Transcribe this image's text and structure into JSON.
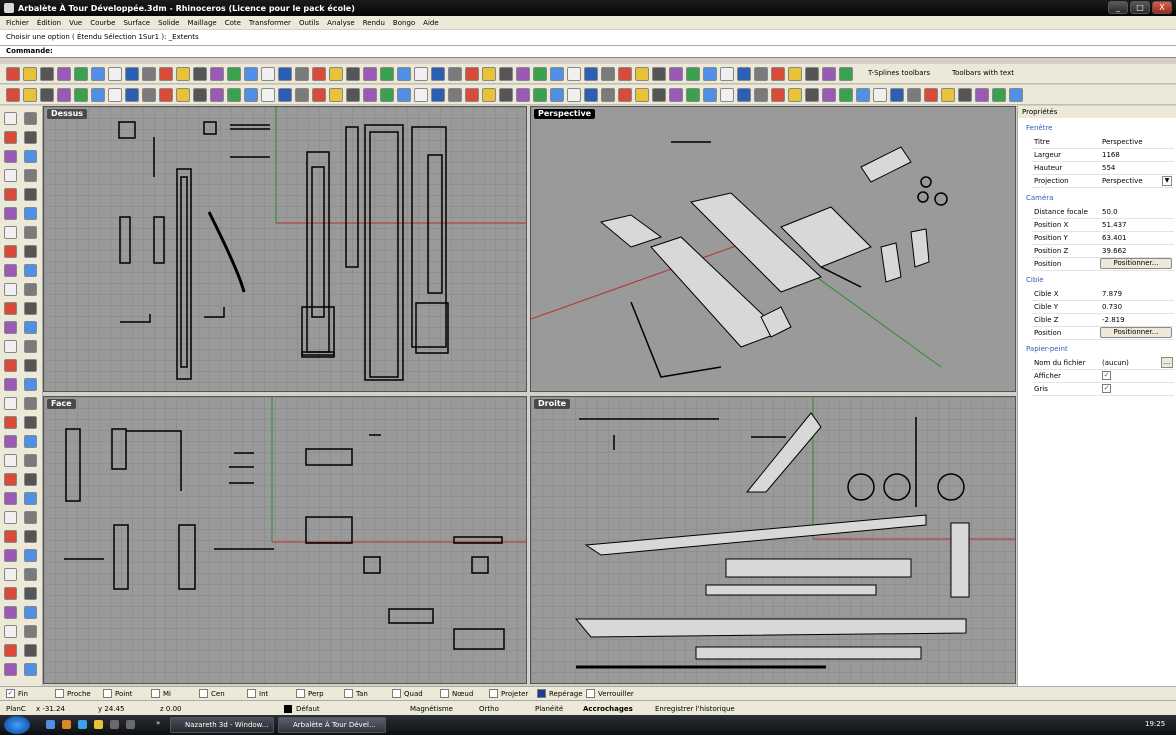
{
  "window": {
    "title": "Arbalète À Tour Développée.3dm - Rhinoceros (Licence pour le pack école)",
    "minimize": "_",
    "maximize": "□",
    "close": "X"
  },
  "menu": [
    "Fichier",
    "Édition",
    "Vue",
    "Courbe",
    "Surface",
    "Solide",
    "Maillage",
    "Cote",
    "Transformer",
    "Outils",
    "Analyse",
    "Rendu",
    "Bongo",
    "Aide"
  ],
  "command": {
    "history": "Choisir une option ( Étendu  Sélection  1Sur1 ): _Extents",
    "prompt": "Commande:",
    "value": ""
  },
  "toolbar": {
    "tsplines_label": "T-Splines toolbars",
    "toolbars_text_label": "Toolbars with text"
  },
  "viewports": {
    "top": "Dessus",
    "perspective": "Perspective",
    "front": "Face",
    "right": "Droite"
  },
  "properties": {
    "header": "Propriétés",
    "window_section": "Fenêtre",
    "rows": [
      {
        "k": "Titre",
        "v": "Perspective"
      },
      {
        "k": "Largeur",
        "v": "1168"
      },
      {
        "k": "Hauteur",
        "v": "554"
      },
      {
        "k": "Projection",
        "v": "Perspective"
      }
    ],
    "camera_section": "Caméra",
    "camera": [
      {
        "k": "Distance focale",
        "v": "50.0"
      },
      {
        "k": "Position X",
        "v": "51.437"
      },
      {
        "k": "Position Y",
        "v": "63.401"
      },
      {
        "k": "Position Z",
        "v": "39.662"
      },
      {
        "k": "Position",
        "v": "Positionner..."
      }
    ],
    "target_section": "Cible",
    "target": [
      {
        "k": "Cible X",
        "v": "7.879"
      },
      {
        "k": "Cible Y",
        "v": "0.730"
      },
      {
        "k": "Cible Z",
        "v": "-2.819"
      },
      {
        "k": "Position",
        "v": "Positionner..."
      }
    ],
    "wallpaper_section": "Papier-peint",
    "wallpaper": [
      {
        "k": "Nom du fichier",
        "v": "(aucun)"
      },
      {
        "k": "Afficher",
        "v": "✓"
      },
      {
        "k": "Gris",
        "v": "✓"
      }
    ],
    "browse": "..."
  },
  "snaps": [
    {
      "label": "Fin",
      "checked": true
    },
    {
      "label": "Proche",
      "checked": false
    },
    {
      "label": "Point",
      "checked": false
    },
    {
      "label": "Mi",
      "checked": false
    },
    {
      "label": "Cen",
      "checked": false
    },
    {
      "label": "Int",
      "checked": false
    },
    {
      "label": "Perp",
      "checked": false
    },
    {
      "label": "Tan",
      "checked": false
    },
    {
      "label": "Quad",
      "checked": false
    },
    {
      "label": "Nœud",
      "checked": false
    },
    {
      "label": "Projeter",
      "checked": false
    },
    {
      "label": "Repérage",
      "checked": true
    },
    {
      "label": "Verrouiller",
      "checked": false
    }
  ],
  "status": {
    "cplane": "PlanC",
    "x": "x -31.24",
    "y": "y 24.45",
    "z": "z 0.00",
    "layer": "Défaut",
    "magnetisme": "Magnétisme",
    "ortho": "Ortho",
    "planeite": "Planéité",
    "accrochages": "Accrochages",
    "historique": "Enregistrer l'historique"
  },
  "taskbar": {
    "task1": "Nazareth 3d - Window...",
    "task2": "Arbalète À Tour Dével...",
    "clock": "19:25",
    "more": "»"
  },
  "colors": {
    "x_axis": "#b83030",
    "y_axis": "#2e8b2e",
    "viewport_bg": "#9a9a9a",
    "section_blue": "#2c5fb3"
  }
}
